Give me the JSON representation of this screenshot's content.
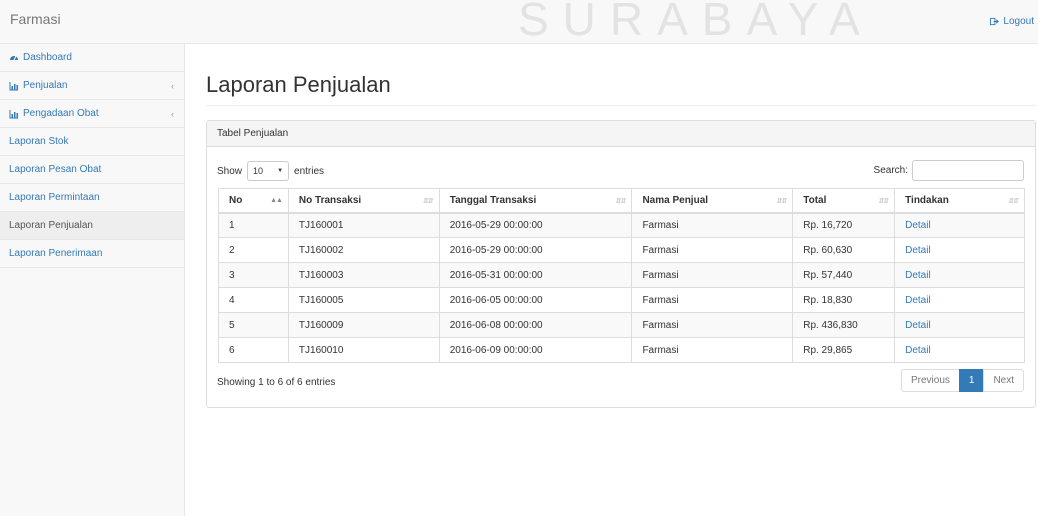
{
  "navbar": {
    "brand": "Farmasi",
    "watermark": "SURABAYA",
    "logout_label": "Logout"
  },
  "sidebar": {
    "items": [
      {
        "label": "Dashboard"
      },
      {
        "label": "Penjualan"
      },
      {
        "label": "Pengadaan Obat"
      },
      {
        "label": "Laporan Stok"
      },
      {
        "label": "Laporan Pesan Obat"
      },
      {
        "label": "Laporan Permintaan"
      },
      {
        "label": "Laporan Penjualan"
      },
      {
        "label": "Laporan Penerimaan"
      }
    ],
    "active": "Laporan Penjualan"
  },
  "page": {
    "title": "Laporan Penjualan"
  },
  "panel": {
    "heading": "Tabel Penjualan",
    "show_label": "Show",
    "entries_value": "10",
    "entries_label": "entries",
    "search_label": "Search:",
    "search_value": ""
  },
  "table": {
    "headers": [
      "No",
      "No Transaksi",
      "Tanggal Transaksi",
      "Nama Penjual",
      "Total",
      "Tindakan"
    ],
    "rows": [
      [
        "1",
        "TJ160001",
        "2016-05-29 00:00:00",
        "Farmasi",
        "Rp. 16,720",
        "Detail"
      ],
      [
        "2",
        "TJ160002",
        "2016-05-29 00:00:00",
        "Farmasi",
        "Rp. 60,630",
        "Detail"
      ],
      [
        "3",
        "TJ160003",
        "2016-05-31 00:00:00",
        "Farmasi",
        "Rp. 57,440",
        "Detail"
      ],
      [
        "4",
        "TJ160005",
        "2016-06-05 00:00:00",
        "Farmasi",
        "Rp. 18,830",
        "Detail"
      ],
      [
        "5",
        "TJ160009",
        "2016-06-08 00:00:00",
        "Farmasi",
        "Rp. 436,830",
        "Detail"
      ],
      [
        "6",
        "TJ160010",
        "2016-06-09 00:00:00",
        "Farmasi",
        "Rp. 29,865",
        "Detail"
      ]
    ]
  },
  "footer": {
    "info": "Showing 1 to 6 of 6 entries",
    "previous_label": "Previous",
    "current_page": "1",
    "next_label": "Next"
  },
  "colors": {
    "link": "#337ab7",
    "active_page": "#337ab7"
  }
}
